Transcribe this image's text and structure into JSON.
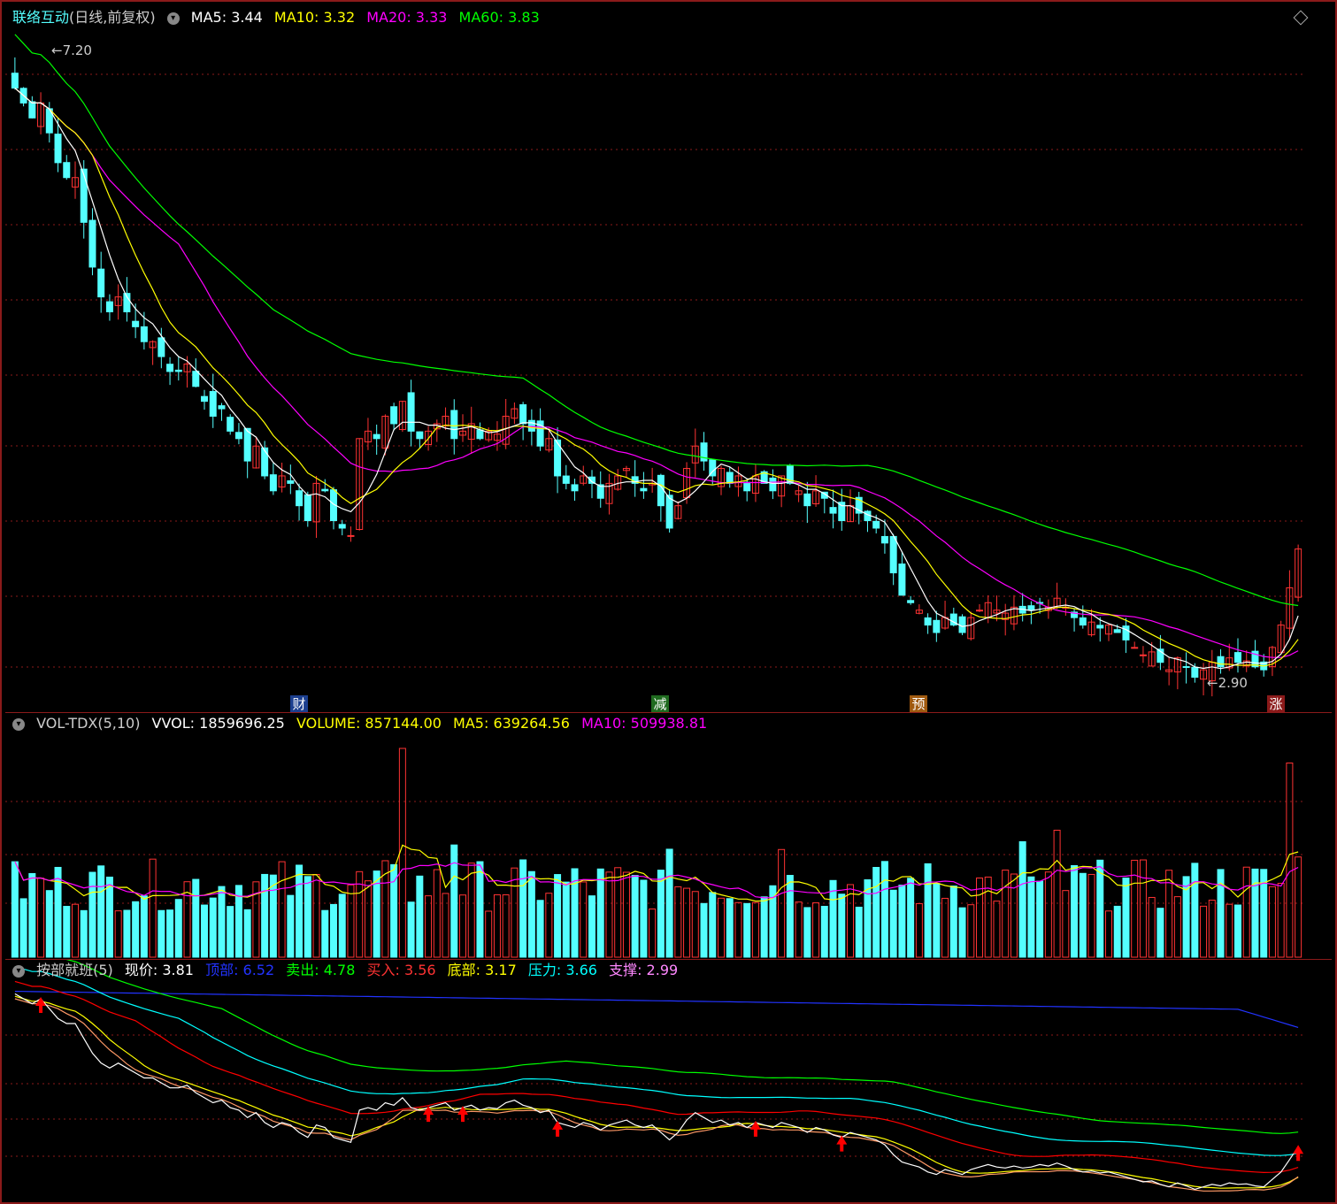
{
  "stock": {
    "name": "联络互动",
    "mode": "(日线,前复权)"
  },
  "main_header": [
    {
      "key": "ma5",
      "text": "MA5: 3.44",
      "color": "#ffffff"
    },
    {
      "key": "ma10",
      "text": "MA10: 3.32",
      "color": "#ffff00"
    },
    {
      "key": "ma20",
      "text": "MA20: 3.33",
      "color": "#ff00ff"
    },
    {
      "key": "ma60",
      "text": "MA60: 3.83",
      "color": "#00ff00"
    }
  ],
  "price_labels": {
    "high": "7.20",
    "low": "2.90"
  },
  "events": [
    {
      "text": "财",
      "bg": "#1c3f8f"
    },
    {
      "text": "减",
      "bg": "#1f6b1f"
    },
    {
      "text": "预",
      "bg": "#a05a10"
    },
    {
      "text": "涨",
      "bg": "#8b1a1a"
    }
  ],
  "vol_header": [
    {
      "text": "VOL-TDX(5,10)",
      "color": "#cccccc"
    },
    {
      "text": "VVOL: 1859696.25",
      "color": "#ffffff"
    },
    {
      "text": "VOLUME: 857144.00",
      "color": "#ffff00"
    },
    {
      "text": "MA5: 639264.56",
      "color": "#ffff00"
    },
    {
      "text": "MA10: 509938.81",
      "color": "#ff00ff"
    }
  ],
  "ind_header": [
    {
      "text": "按部就班(5)",
      "color": "#cccccc"
    },
    {
      "text": "现价: 3.81",
      "color": "#ffffff"
    },
    {
      "text": "顶部: 6.52",
      "color": "#0000ff"
    },
    {
      "text": "卖出: 4.78",
      "color": "#00ff00"
    },
    {
      "text": "买入: 3.56",
      "color": "#ff0000"
    },
    {
      "text": "底部: 3.17",
      "color": "#ffff00"
    },
    {
      "text": "压力: 3.66",
      "color": "#00ffff"
    },
    {
      "text": "支撑: 2.99",
      "color": "#ff80ff"
    }
  ],
  "colors": {
    "up": "#ff3333",
    "down": "#54ffff",
    "ma5": "#ffffff",
    "ma10": "#ffff00",
    "ma20": "#ff00ff",
    "ma60": "#00ff00",
    "grid": "#8b1a1a"
  },
  "chart_data": {
    "type": "candlestick",
    "price_range": [
      2.9,
      7.2
    ],
    "closes": [
      6.9,
      6.8,
      6.7,
      6.8,
      6.6,
      6.4,
      6.3,
      6.3,
      6.0,
      5.7,
      5.5,
      5.4,
      5.5,
      5.4,
      5.3,
      5.2,
      5.2,
      5.1,
      5.0,
      5.0,
      5.05,
      4.9,
      4.8,
      4.7,
      4.75,
      4.6,
      4.55,
      4.4,
      4.5,
      4.3,
      4.2,
      4.3,
      4.25,
      4.1,
      4.0,
      4.25,
      4.2,
      4.0,
      3.95,
      3.9,
      4.55,
      4.6,
      4.55,
      4.7,
      4.65,
      4.8,
      4.6,
      4.55,
      4.6,
      4.65,
      4.7,
      4.55,
      4.6,
      4.65,
      4.55,
      4.6,
      4.58,
      4.7,
      4.75,
      4.65,
      4.6,
      4.5,
      4.55,
      4.3,
      4.25,
      4.2,
      4.3,
      4.25,
      4.15,
      4.25,
      4.3,
      4.35,
      4.25,
      4.2,
      4.25,
      4.1,
      3.95,
      4.1,
      4.35,
      4.5,
      4.4,
      4.3,
      4.35,
      4.25,
      4.3,
      4.2,
      4.3,
      4.25,
      4.2,
      4.3,
      4.25,
      4.2,
      4.1,
      4.2,
      4.15,
      4.05,
      4.0,
      4.1,
      4.05,
      4.0,
      3.95,
      3.85,
      3.65,
      3.5,
      3.45,
      3.4,
      3.3,
      3.25,
      3.35,
      3.3,
      3.25,
      3.35,
      3.4,
      3.45,
      3.4,
      3.38,
      3.42,
      3.38,
      3.4,
      3.45,
      3.42,
      3.48,
      3.42,
      3.35,
      3.3,
      3.32,
      3.28,
      3.3,
      3.25,
      3.2,
      3.15,
      3.1,
      3.12,
      3.05,
      3.0,
      3.08,
      3.02,
      2.95,
      3.0,
      3.05,
      3.02,
      3.08,
      3.05,
      3.06,
      3.02,
      3.0,
      3.15,
      3.3,
      3.55,
      3.81
    ],
    "volume_peak": 1859696.25
  }
}
